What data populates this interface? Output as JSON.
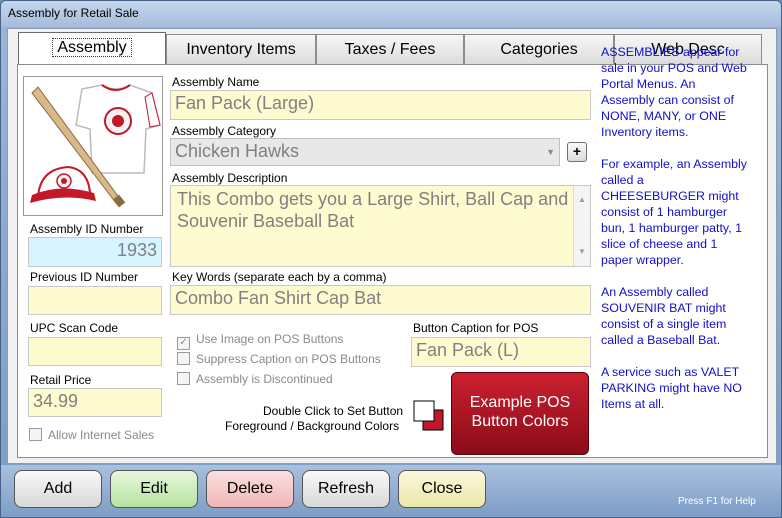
{
  "window": {
    "title": "Assembly for Retail Sale"
  },
  "tabs": [
    {
      "label": "Assembly",
      "active": true
    },
    {
      "label": "Inventory Items"
    },
    {
      "label": "Taxes  / Fees"
    },
    {
      "label": "Categories"
    },
    {
      "label": "Web Desc"
    }
  ],
  "form": {
    "assembly_name_label": "Assembly Name",
    "assembly_name": "Fan Pack (Large)",
    "category_label": "Assembly Category",
    "category": "Chicken Hawks",
    "add_category_symbol": "+",
    "description_label": "Assembly Description",
    "description": "This Combo gets you a Large Shirt, Ball Cap and Souvenir Baseball Bat",
    "id_label": "Assembly ID Number",
    "id": "1933",
    "prev_id_label": "Previous ID Number",
    "prev_id": "",
    "keywords_label": "Key Words (separate each by a comma)",
    "keywords": "Combo Fan Shirt Cap Bat",
    "upc_label": "UPC Scan Code",
    "upc": "",
    "price_label": "Retail Price",
    "price": "34.99",
    "allow_internet_label": "Allow Internet Sales",
    "use_image_label": "Use Image on POS Buttons",
    "suppress_caption_label": "Suppress Caption on POS Buttons",
    "discontinued_label": "Assembly is Discontinued",
    "caption_label": "Button Caption for POS",
    "caption": "Fan Pack (L)",
    "color_hint_line1": "Double Click to Set Button",
    "color_hint_line2": "Foreground / Background Colors",
    "example_line1": "Example POS",
    "example_line2": "Button Colors",
    "pos_colors": {
      "foreground": "#ffffff",
      "background": "#c0172a"
    }
  },
  "info": {
    "p1": "ASSEMBLIES appear for sale in your POS and Web Portal  Menus.  An Assembly can consist of NONE, MANY, or ONE Inventory items.",
    "p2": "For example, an Assembly called a CHEESEBURGER might consist of 1 hamburger bun, 1 hamburger patty, 1 slice of cheese and 1 paper wrapper.",
    "p3": "An Assembly called SOUVENIR BAT might consist of a single item called a Baseball Bat.",
    "p4": "A service such as VALET PARKING might have NO Items at all."
  },
  "buttons": {
    "add": "Add",
    "edit": "Edit",
    "delete": "Delete",
    "refresh": "Refresh",
    "close": "Close"
  },
  "help_hint": "Press F1 for Help",
  "icons": {
    "image": "baseball-merch-image",
    "dropdown": "chevron-down-icon"
  }
}
